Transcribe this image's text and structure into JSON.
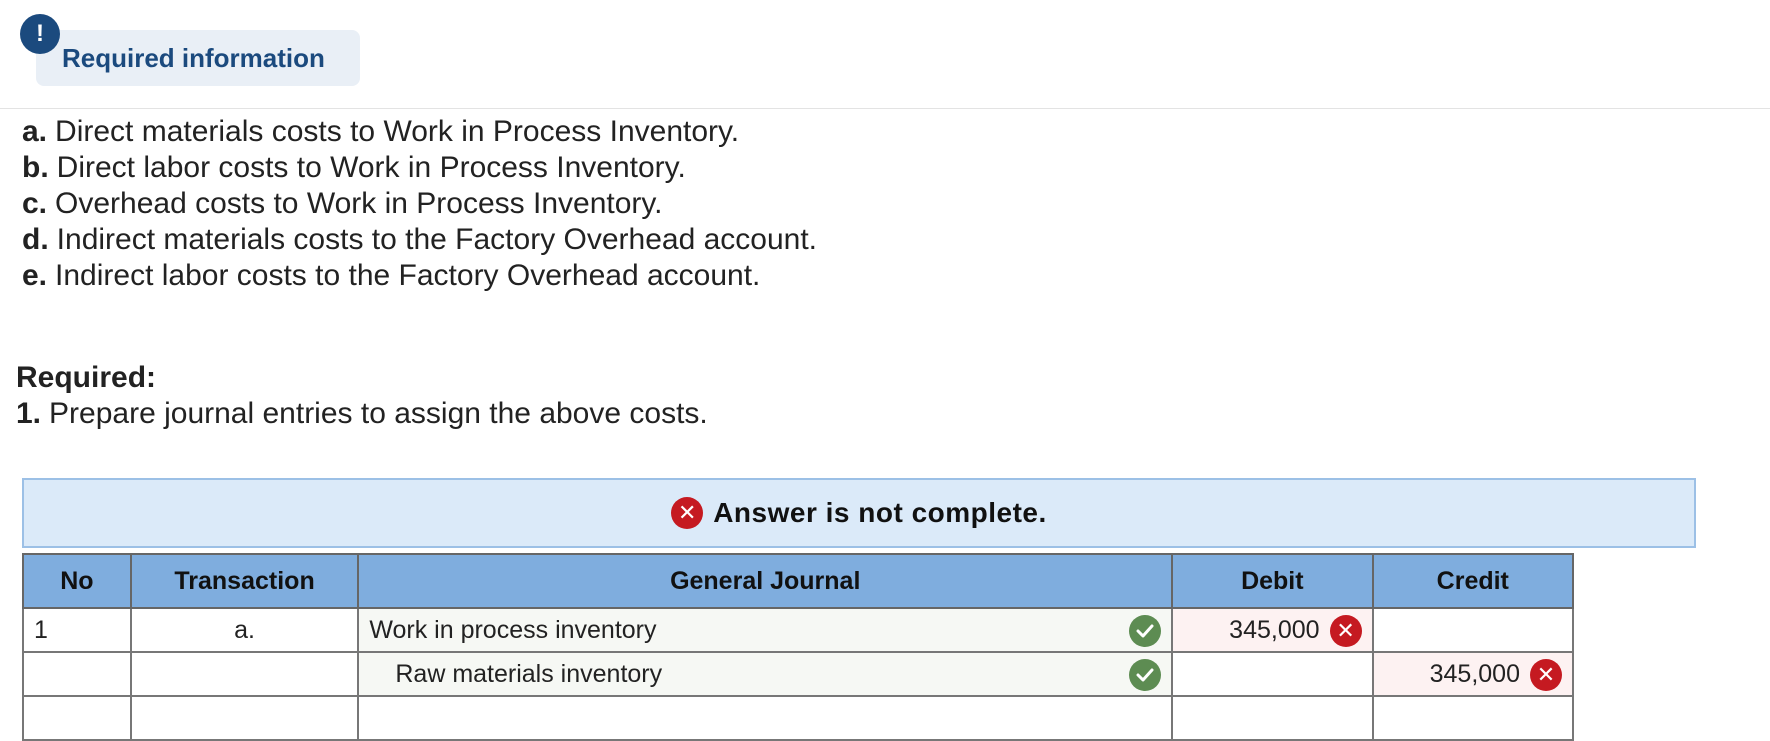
{
  "info": {
    "title": "Required information",
    "icon": "exclamation-icon",
    "icon_glyph": "!"
  },
  "items": [
    {
      "key": "a.",
      "text": "Direct materials costs to Work in Process Inventory."
    },
    {
      "key": "b.",
      "text": "Direct labor costs to Work in Process Inventory."
    },
    {
      "key": "c.",
      "text": "Overhead costs to Work in Process Inventory."
    },
    {
      "key": "d.",
      "text": "Indirect materials costs to the Factory Overhead account."
    },
    {
      "key": "e.",
      "text": "Indirect labor costs to the Factory Overhead account."
    }
  ],
  "required": {
    "heading": "Required:",
    "key": "1.",
    "text": "Prepare journal entries to assign the above costs."
  },
  "banner": {
    "text": "Answer is not complete.",
    "icon": "x-circle-icon"
  },
  "table": {
    "headers": {
      "no": "No",
      "transaction": "Transaction",
      "journal": "General Journal",
      "debit": "Debit",
      "credit": "Credit"
    },
    "rows": [
      {
        "no": "1",
        "transaction": "a.",
        "account": "Work in process inventory",
        "debit": "345,000",
        "credit": ""
      },
      {
        "no": "",
        "transaction": "",
        "account": "Raw materials inventory",
        "debit": "",
        "credit": "345,000"
      },
      {
        "no": "",
        "transaction": "",
        "account": "",
        "debit": "",
        "credit": ""
      }
    ]
  },
  "colors": {
    "header_blue": "#7fadde",
    "banner_bg": "#dbeaf9",
    "error_red": "#c51a21",
    "check_green": "#5d8c52",
    "info_blue": "#1b4a7e"
  }
}
